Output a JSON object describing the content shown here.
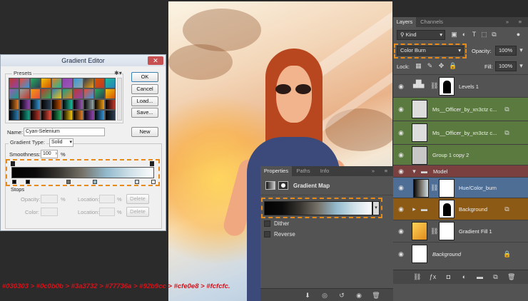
{
  "gradient_editor": {
    "title": "Gradient Editor",
    "close_glyph": "✕",
    "presets_label": "Presets",
    "buttons": {
      "ok": "OK",
      "cancel": "Cancel",
      "load": "Load...",
      "save": "Save...",
      "new": "New",
      "delete": "Delete"
    },
    "name_label": "Name:",
    "name_value": "Cyan-Selenium",
    "gradient_type_label": "Gradient Type:",
    "gradient_type_value": "Solid",
    "smoothness_label": "Smoothness:",
    "smoothness_value": "100",
    "percent": "%",
    "stops_label": "Stops",
    "opacity_label": "Opacity:",
    "color_label": "Color:",
    "location_label": "Location:",
    "preset_colors": [
      "#c0392b",
      "#e74c3c",
      "#27ae60",
      "#f1c40f",
      "#e67e22",
      "#8e44ad",
      "#3498db",
      "#2c3e50",
      "#d35400",
      "#1abc9c",
      "#9b59b6",
      "#95a5a6",
      "#f39c12",
      "#c0392b",
      "#2980b9",
      "#16a085"
    ],
    "gradient_stops": [
      "#030303",
      "#0c0b0b",
      "#3a3732",
      "#77736a",
      "#92b9cc",
      "#cfe0e8",
      "#fcfcfc"
    ]
  },
  "properties": {
    "tabs": [
      "Properties",
      "Paths",
      "Info"
    ],
    "title": "Gradient Map",
    "dither_label": "Dither",
    "reverse_label": "Reverse"
  },
  "layers": {
    "tabs": [
      "Layers",
      "Channels"
    ],
    "filter_kind": "Kind",
    "blend_mode": "Color Burn",
    "opacity_label": "Opacity:",
    "opacity_value": "100%",
    "lock_label": "Lock:",
    "fill_label": "Fill:",
    "fill_value": "100%",
    "items": [
      {
        "name": "Levels 1"
      },
      {
        "name": "Ms__Officer_by_xn3ctz c..."
      },
      {
        "name": "Ms__Officer_by_xn3ctz c..."
      },
      {
        "name": "Group 1 copy 2"
      },
      {
        "name": "Model"
      },
      {
        "name": "Hue/Color_burn"
      },
      {
        "name": "Background"
      },
      {
        "name": "Gradient Fill 1"
      },
      {
        "name": "Background"
      }
    ],
    "colors": {
      "green_row": "#5b7a3f",
      "red_row": "#7a3f3f",
      "blue_row": "#4e6e96",
      "orange_row": "#8c5a14"
    }
  },
  "caption": "#030303 > #0c0b0b > #3a3732 > #77736a > #92b9cc > #cfe0e8 > #fcfcfc."
}
